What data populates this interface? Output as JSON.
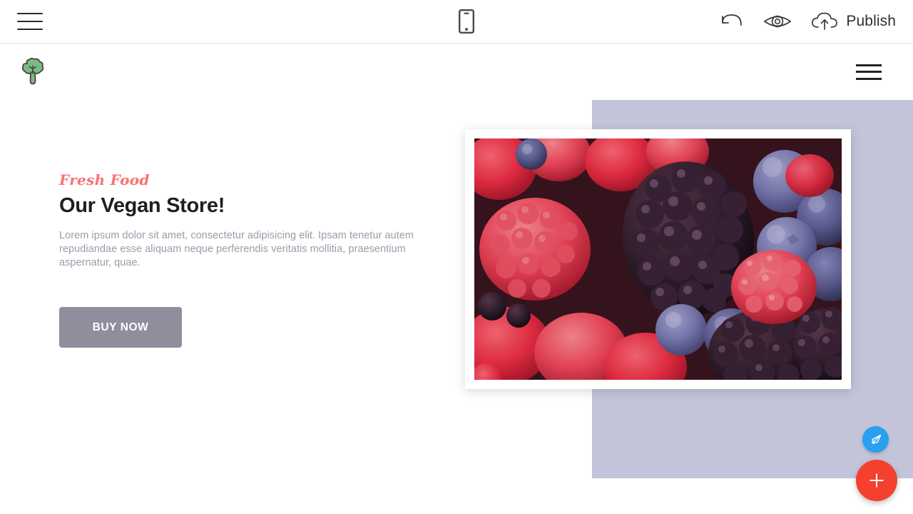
{
  "editor_toolbar": {
    "menu_icon": "hamburger-menu-icon",
    "device_preview_icon": "mobile-phone-icon",
    "undo_icon": "undo-arrow-icon",
    "preview_icon": "eye-preview-icon",
    "publish_icon": "cloud-upload-icon",
    "publish_label": "Publish"
  },
  "site_header": {
    "logo_icon": "broccoli-logo-icon",
    "menu_icon": "hamburger-menu-icon"
  },
  "hero": {
    "subtitle": "Fresh Food",
    "title": "Our Vegan Store!",
    "paragraph": "Lorem ipsum dolor sit amet, consectetur adipisicing elit. Ipsam tenetur autem repudiandae esse aliquam neque perferendis veritatis mollitia, praesentium aspernatur, quae.",
    "cta_label": "BUY NOW",
    "image_alt": "mixed-berries-photo"
  },
  "floating_actions": {
    "style_icon": "paintbrush-icon",
    "add_icon": "plus-icon"
  },
  "colors": {
    "accent_pink": "#fa7272",
    "panel_lavender": "#c3c4da",
    "cta_gray": "#8e8e9c",
    "fab_blue": "#29a0f0",
    "fab_red": "#f4402e",
    "logo_green": "#7ab98a"
  }
}
